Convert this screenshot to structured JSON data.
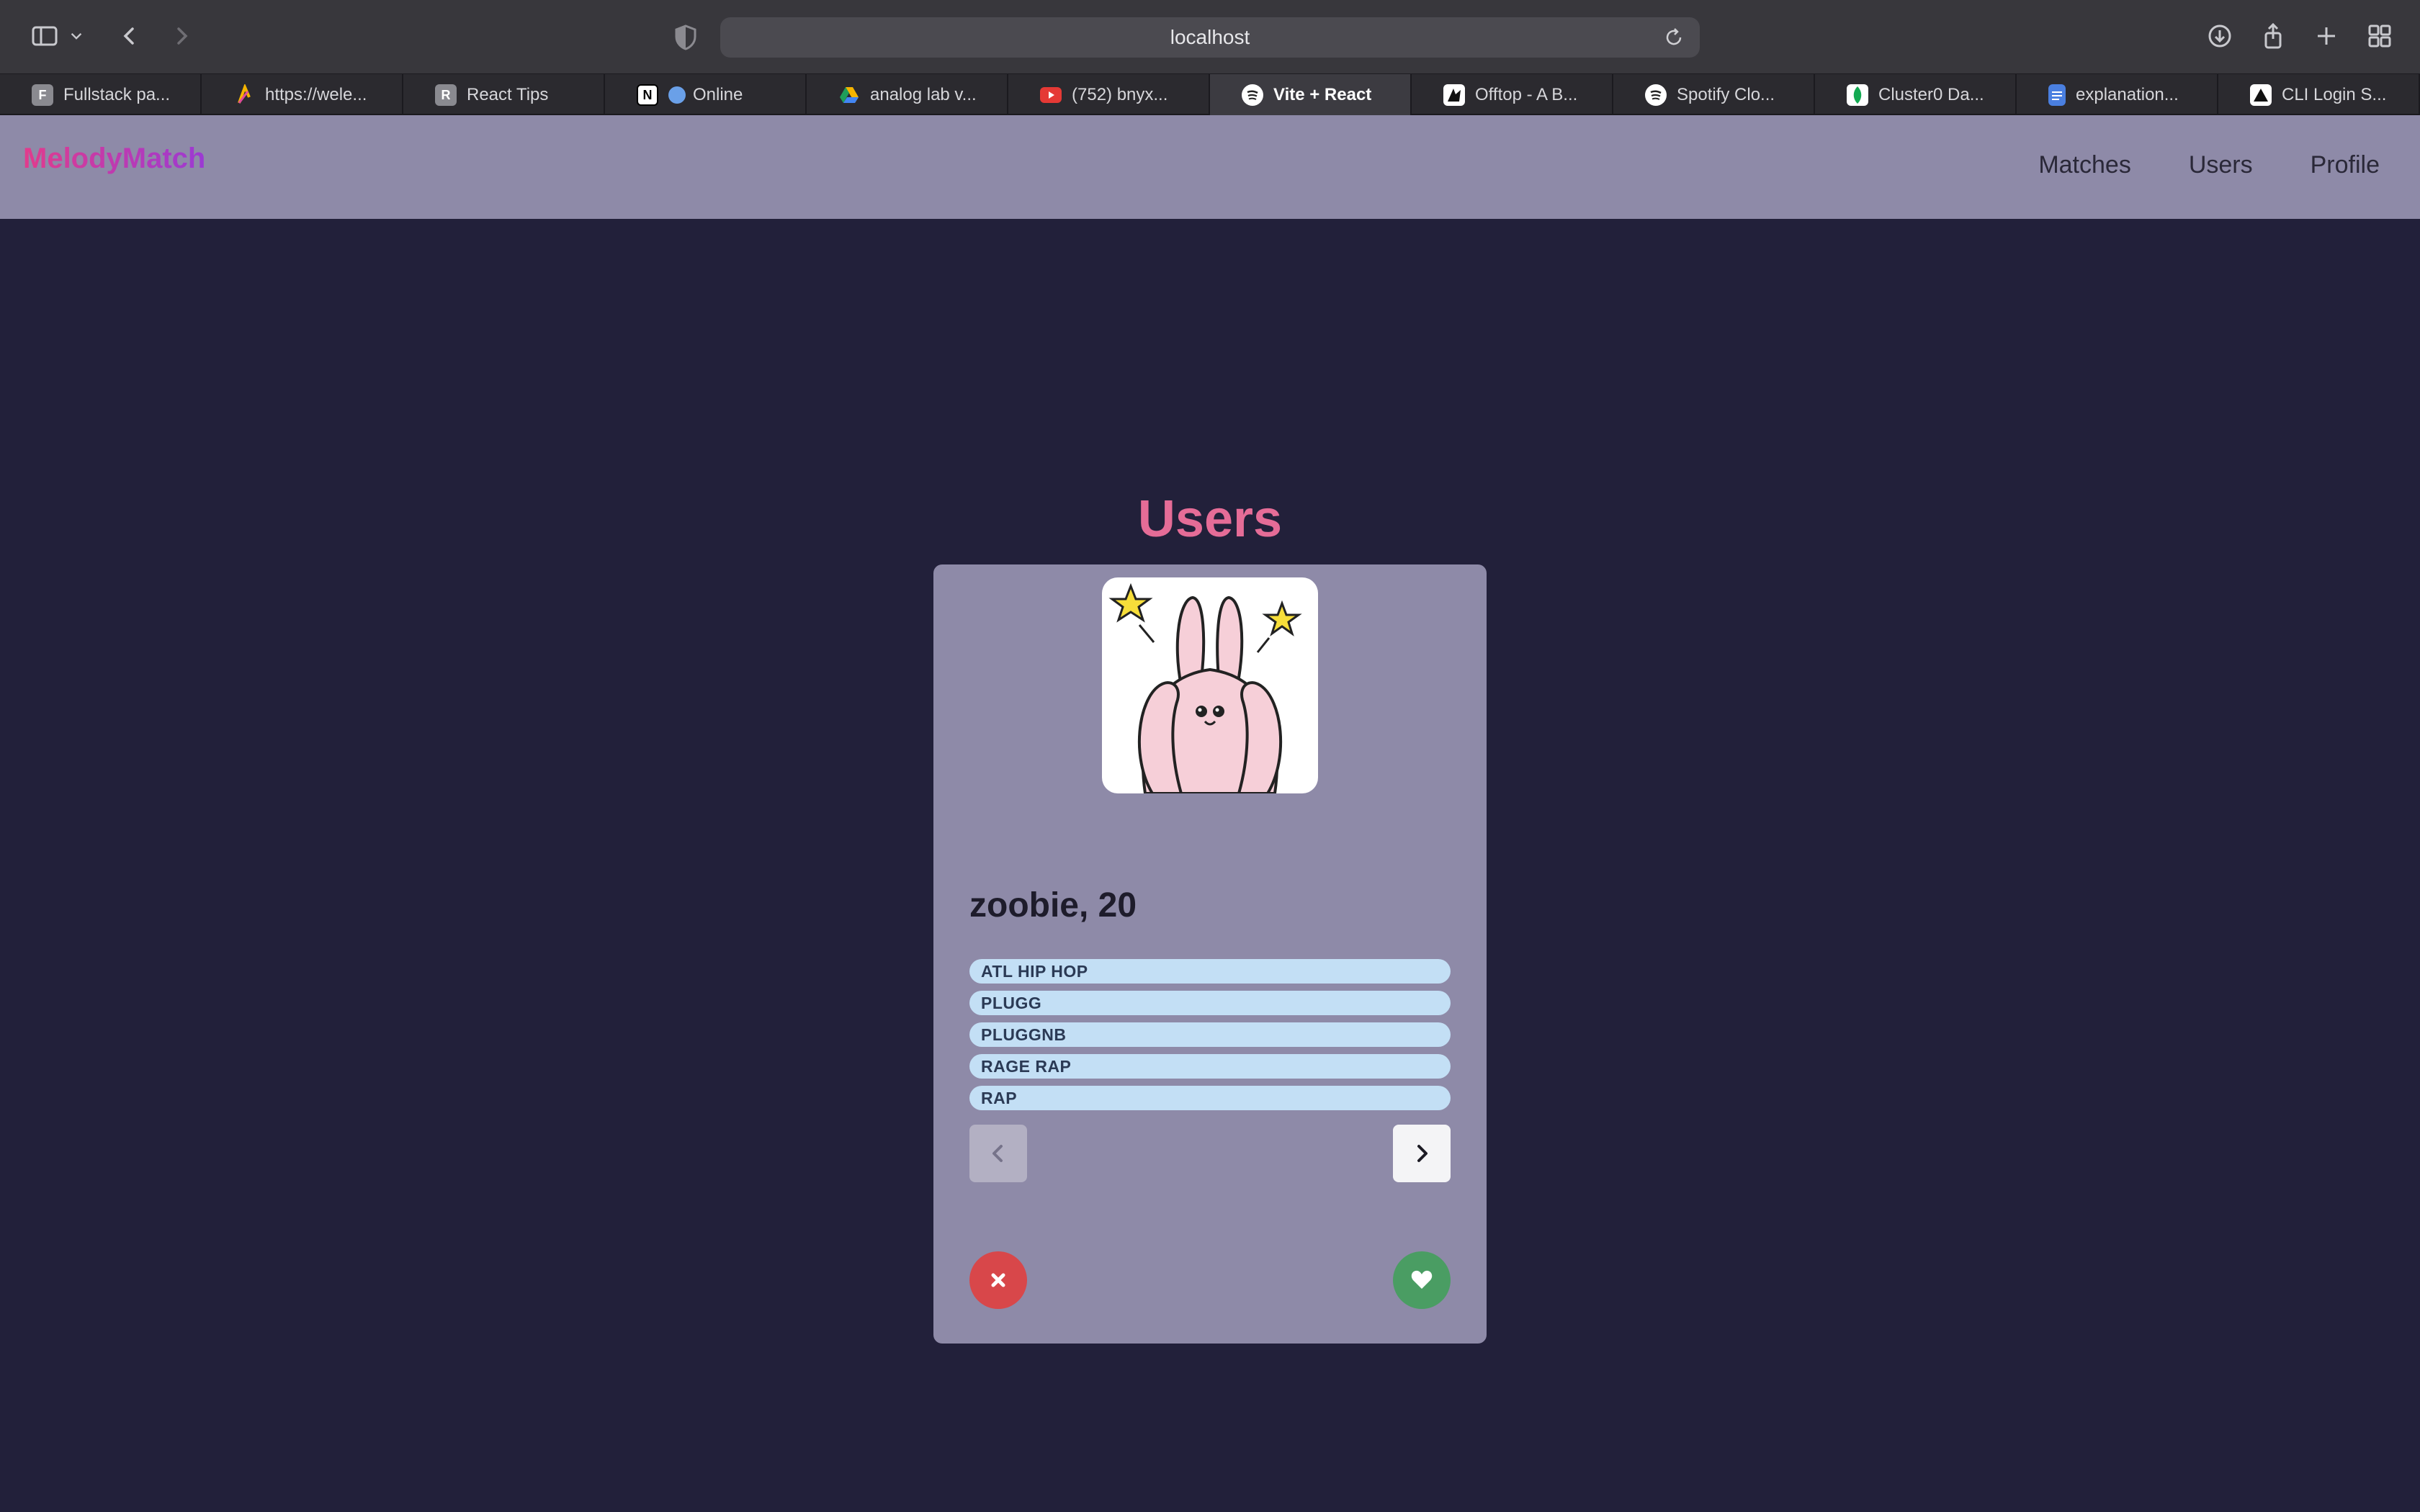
{
  "browser": {
    "url": "localhost",
    "tabs": [
      {
        "label": "Fullstack pa...",
        "favicon": "F",
        "favicon_color": "#8a8a90"
      },
      {
        "label": "https://wele...",
        "favicon": "",
        "favicon_color": "#2b2a2f"
      },
      {
        "label": "React Tips",
        "favicon": "R",
        "favicon_color": "#8a8a90"
      },
      {
        "label": "Online",
        "favicon": "N",
        "favicon_color": "#ffffff"
      },
      {
        "label": "analog lab v...",
        "favicon": "",
        "favicon_color": "#2b2a2f"
      },
      {
        "label": "(752) bnyx...",
        "favicon": "",
        "favicon_color": "#e53935"
      },
      {
        "label": "Vite + React",
        "favicon": "",
        "favicon_color": "#2b2a2f",
        "active": true
      },
      {
        "label": "Offtop - A B...",
        "favicon": "",
        "favicon_color": "#ffffff"
      },
      {
        "label": "Spotify Clo...",
        "favicon": "",
        "favicon_color": "#ffffff"
      },
      {
        "label": "Cluster0 Da...",
        "favicon": "",
        "favicon_color": "#2b2a2f"
      },
      {
        "label": "explanation...",
        "favicon": "",
        "favicon_color": "#4a7fe0"
      },
      {
        "label": "CLI Login S...",
        "favicon": "",
        "favicon_color": "#ffffff"
      }
    ]
  },
  "app": {
    "brand": "MelodyMatch",
    "nav": {
      "matches": "Matches",
      "users": "Users",
      "profile": "Profile"
    }
  },
  "main": {
    "title": "Users",
    "user": {
      "name_age": "zoobie, 20",
      "genres": [
        "ATL HIP HOP",
        "PLUGG",
        "PLUGGNB",
        "RAGE RAP",
        "RAP"
      ]
    }
  },
  "colors": {
    "background": "#22203a",
    "nav_bg": "#8e8aa8",
    "title": "#e56c97",
    "reject": "#d8474a",
    "like": "#4a9d63",
    "genre_chip": "#c3dff5"
  },
  "icons": {
    "reject": "close-icon",
    "like": "heart-icon",
    "prev": "chevron-left-icon",
    "next": "chevron-right-icon"
  }
}
